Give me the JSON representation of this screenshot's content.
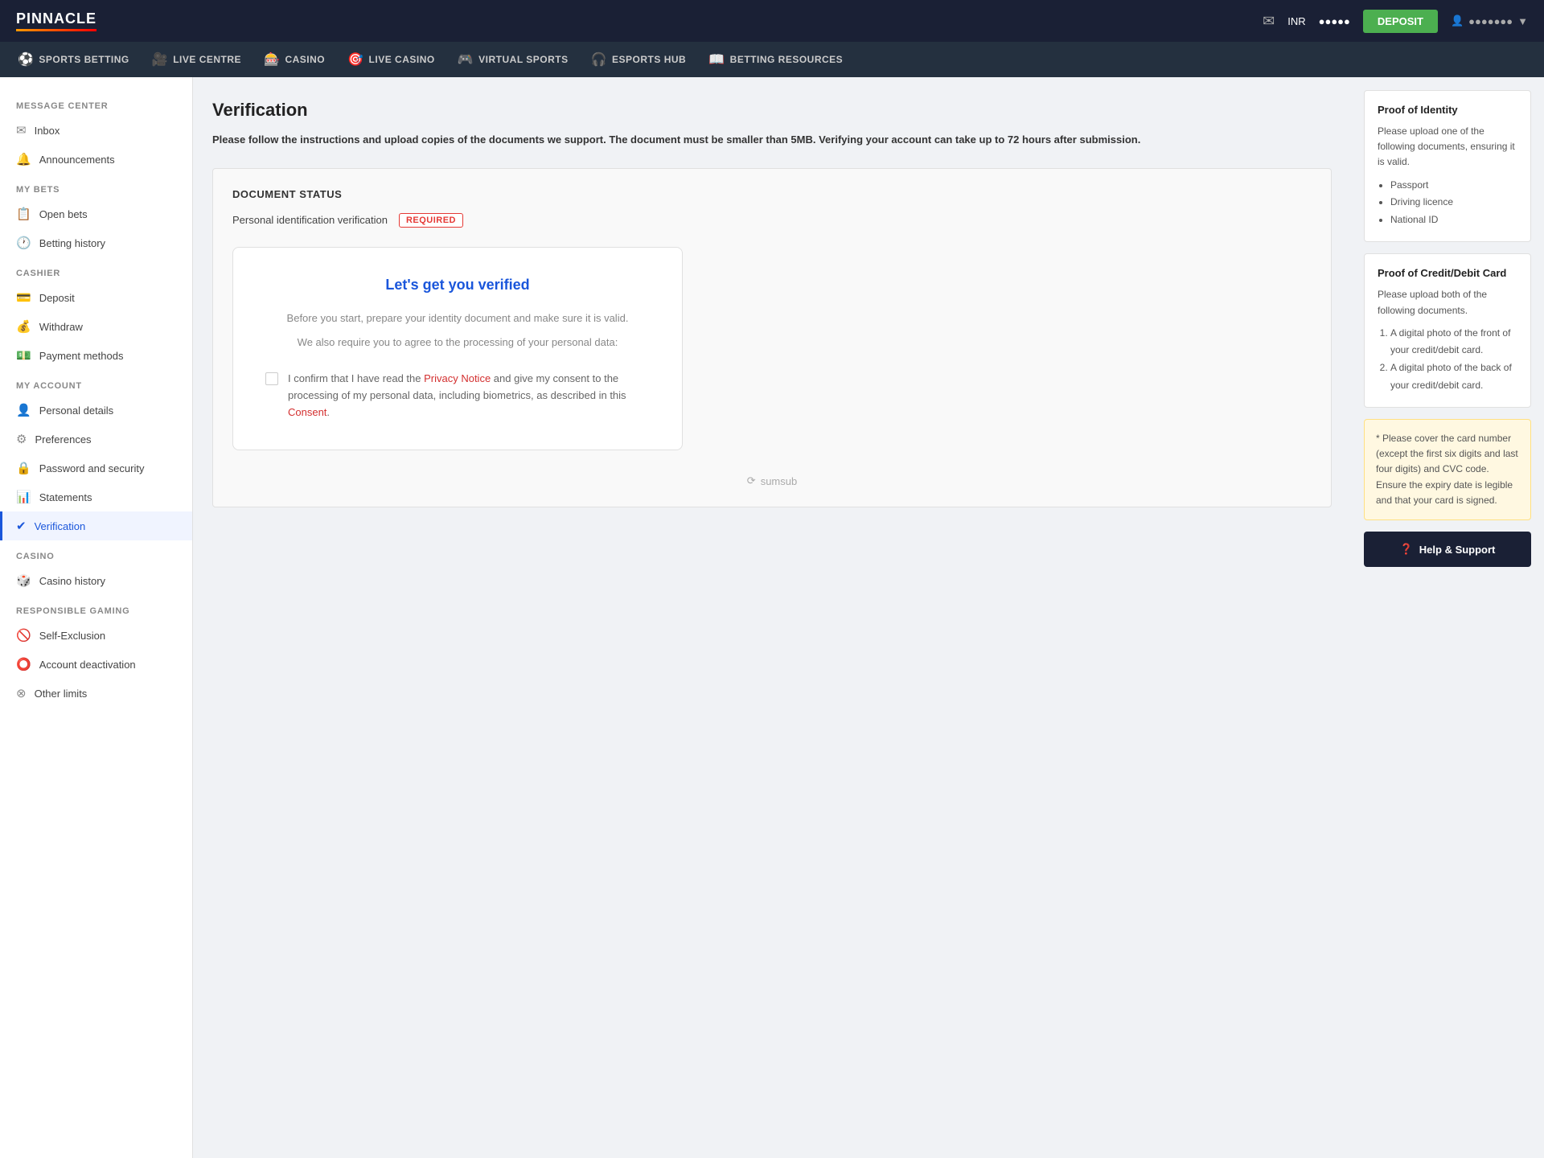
{
  "topNav": {
    "logo": "PINNACLE",
    "currency": "INR",
    "balance": "●●●●●",
    "depositLabel": "DEPOSIT",
    "username": "●●●●●●●"
  },
  "secNav": {
    "items": [
      {
        "label": "SPORTS BETTING",
        "icon": "⚽"
      },
      {
        "label": "LIVE CENTRE",
        "icon": "🎥"
      },
      {
        "label": "CASINO",
        "icon": "🎰"
      },
      {
        "label": "LIVE CASINO",
        "icon": "🎯"
      },
      {
        "label": "VIRTUAL SPORTS",
        "icon": "🎮"
      },
      {
        "label": "ESPORTS HUB",
        "icon": "🎧"
      },
      {
        "label": "BETTING RESOURCES",
        "icon": "📖"
      }
    ]
  },
  "sidebar": {
    "sections": [
      {
        "title": "MESSAGE CENTER",
        "items": [
          {
            "label": "Inbox",
            "icon": "✉",
            "active": false
          },
          {
            "label": "Announcements",
            "icon": "🔔",
            "active": false
          }
        ]
      },
      {
        "title": "MY BETS",
        "items": [
          {
            "label": "Open bets",
            "icon": "📋",
            "active": false
          },
          {
            "label": "Betting history",
            "icon": "🕐",
            "active": false
          }
        ]
      },
      {
        "title": "CASHIER",
        "items": [
          {
            "label": "Deposit",
            "icon": "💳",
            "active": false
          },
          {
            "label": "Withdraw",
            "icon": "💰",
            "active": false
          },
          {
            "label": "Payment methods",
            "icon": "💵",
            "active": false
          }
        ]
      },
      {
        "title": "MY ACCOUNT",
        "items": [
          {
            "label": "Personal details",
            "icon": "👤",
            "active": false
          },
          {
            "label": "Preferences",
            "icon": "⚙",
            "active": false
          },
          {
            "label": "Password and security",
            "icon": "🔒",
            "active": false
          },
          {
            "label": "Statements",
            "icon": "📊",
            "active": false
          },
          {
            "label": "Verification",
            "icon": "✔",
            "active": true
          }
        ]
      },
      {
        "title": "CASINO",
        "items": [
          {
            "label": "Casino history",
            "icon": "🎲",
            "active": false
          }
        ]
      },
      {
        "title": "RESPONSIBLE GAMING",
        "items": [
          {
            "label": "Self-Exclusion",
            "icon": "🚫",
            "active": false
          },
          {
            "label": "Account deactivation",
            "icon": "⭕",
            "active": false
          },
          {
            "label": "Other limits",
            "icon": "⊗",
            "active": false
          }
        ]
      }
    ]
  },
  "main": {
    "pageTitle": "Verification",
    "introText": "Please follow the instructions and upload copies of the documents we support. The document must be smaller than 5MB. Verifying your account can take up to 72 hours after submission.",
    "documentStatus": {
      "sectionTitle": "DOCUMENT STATUS",
      "rowLabel": "Personal identification verification",
      "badge": "REQUIRED"
    },
    "verifyCard": {
      "title": "Let's get you verified",
      "line1": "Before you start, prepare your identity document and make sure it is valid.",
      "line2": "We also require you to agree to the processing of your personal data:",
      "consentText1": "I confirm that I have read the ",
      "consentLink1": "Privacy Notice",
      "consentText2": " and give my consent to the processing of my personal data, including biometrics, as described in this ",
      "consentLink2": "Consent",
      "consentEnd": "."
    },
    "sumsubLabel": "sumsub"
  },
  "rightPanel": {
    "proofOfIdentity": {
      "title": "Proof of Identity",
      "description": "Please upload one of the following documents, ensuring it is valid.",
      "items": [
        "Passport",
        "Driving licence",
        "National ID"
      ]
    },
    "proofOfCard": {
      "title": "Proof of Credit/Debit Card",
      "description": "Please upload both of the following documents.",
      "items": [
        "A digital photo of the front of your credit/debit card.",
        "A digital photo of the back of your credit/debit card."
      ]
    },
    "warningText": "* Please cover the card number (except the first six digits and last four digits) and CVC code. Ensure the expiry date is legible and that your card is signed.",
    "helpButton": "Help & Support"
  }
}
